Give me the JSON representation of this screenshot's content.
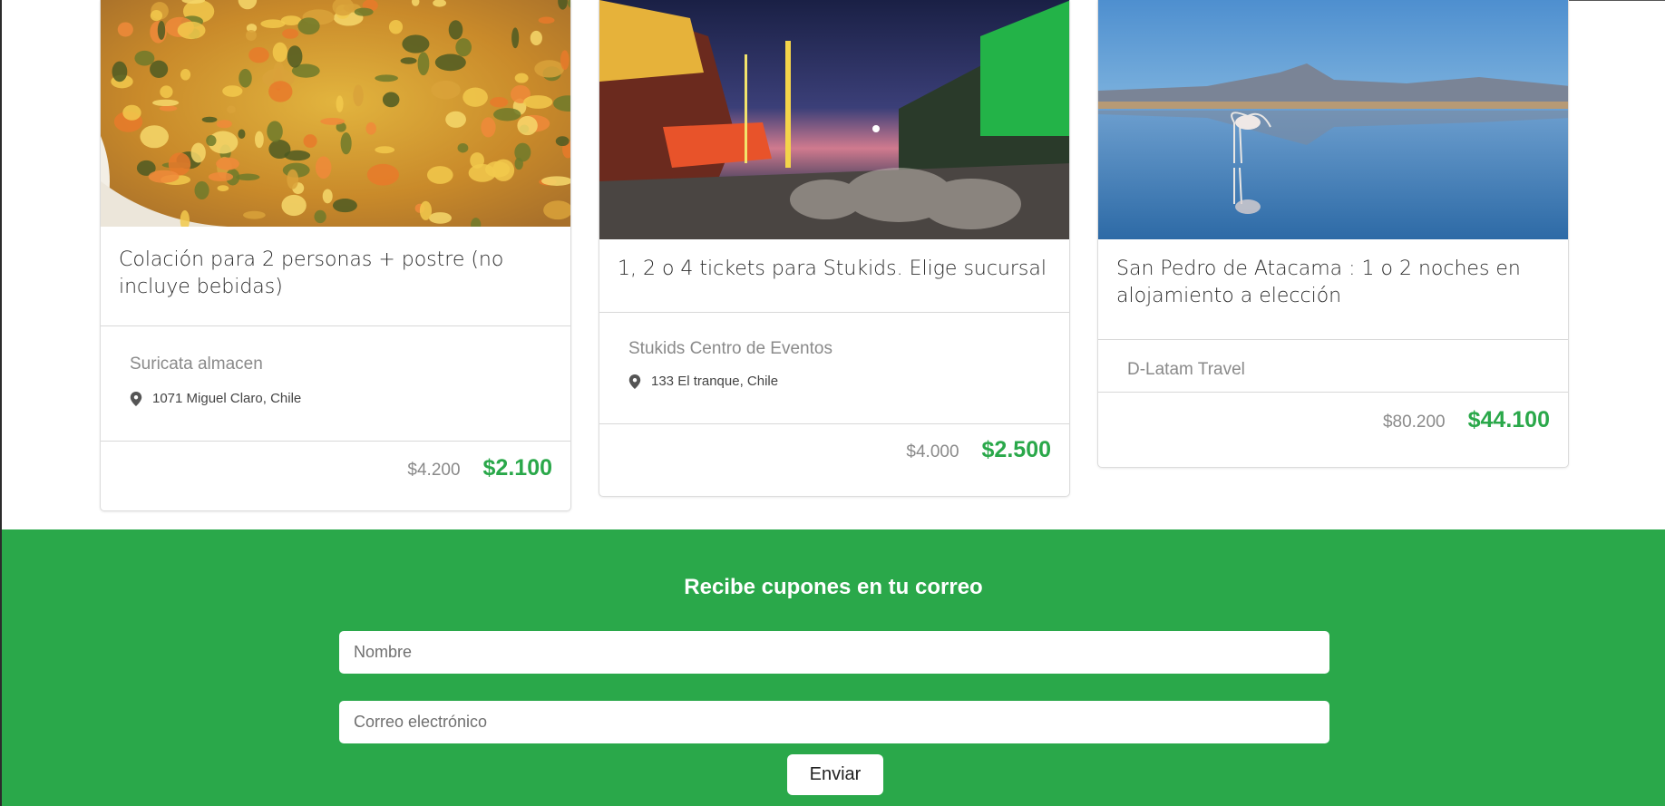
{
  "cards": [
    {
      "title": "Colación para 2 personas + postre (no incluye bebidas)",
      "merchant": "Suricata almacen",
      "address": "1071 Miguel Claro, Chile",
      "old_price": "$4.200",
      "new_price": "$2.100",
      "image": "food-dish-photo"
    },
    {
      "title": "1, 2 o 4 tickets para Stukids. Elige sucursal",
      "merchant": "Stukids Centro de Eventos",
      "address": "133 El tranque, Chile",
      "old_price": "$4.000",
      "new_price": "$2.500",
      "image": "amusement-park-night-photo"
    },
    {
      "title": "San Pedro de Atacama : 1 o 2 noches en alojamiento a elección",
      "merchant": "D-Latam Travel",
      "old_price": "$80.200",
      "new_price": "$44.100",
      "image": "flamingo-lagoon-photo"
    }
  ],
  "newsletter": {
    "title": "Recibe cupones en tu correo",
    "name_placeholder": "Nombre",
    "email_placeholder": "Correo electrónico",
    "submit_label": "Enviar"
  },
  "colors": {
    "brand_green": "#2aa84a",
    "price_green": "#2aa84a"
  }
}
